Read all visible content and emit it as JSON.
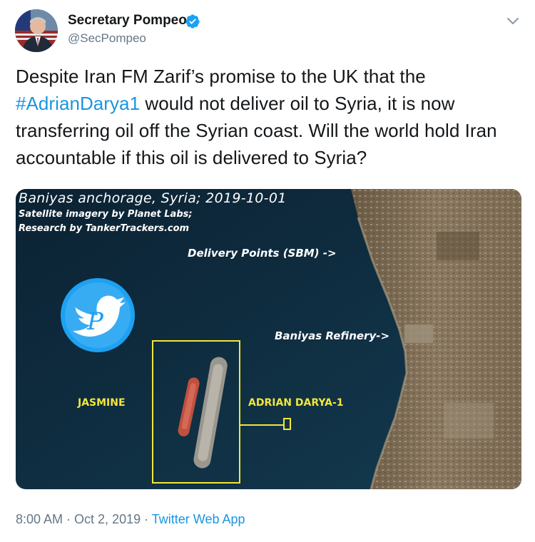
{
  "author": {
    "name": "Secretary Pompeo",
    "handle": "@SecPompeo",
    "verified": true
  },
  "icons": {
    "verified": "verified-badge-icon",
    "menu": "chevron-down-icon",
    "watermark": "twitter-bird-icon"
  },
  "tweet": {
    "text_part1": "Despite Iran FM Zarif’s promise to the UK that the ",
    "hashtag": "#AdrianDarya1",
    "text_part2": " would not deliver oil to Syria, it is now transferring oil off the Syrian coast. Will the world hold Iran accountable if this oil is delivered to Syria?"
  },
  "media": {
    "title": "Baniyas anchorage, Syria; 2019-10-01",
    "credit_line1": "Satellite imagery by Planet Labs;",
    "credit_line2": "Research by TankerTrackers.com",
    "label_delivery": "Delivery Points (SBM) ->",
    "label_refinery": "Baniyas Refinery->",
    "label_jasmine": "JASMINE",
    "label_adrian": "ADRIAN DARYA-1"
  },
  "footer": {
    "time": "8:00 AM",
    "separator": " · ",
    "date": "Oct 2, 2019",
    "source": "Twitter Web App"
  },
  "colors": {
    "link": "#1b95e0",
    "secondary": "#657786",
    "primary_text": "#14171a",
    "annotation_yellow": "#f2e63a",
    "sea": "#0d2b40"
  }
}
